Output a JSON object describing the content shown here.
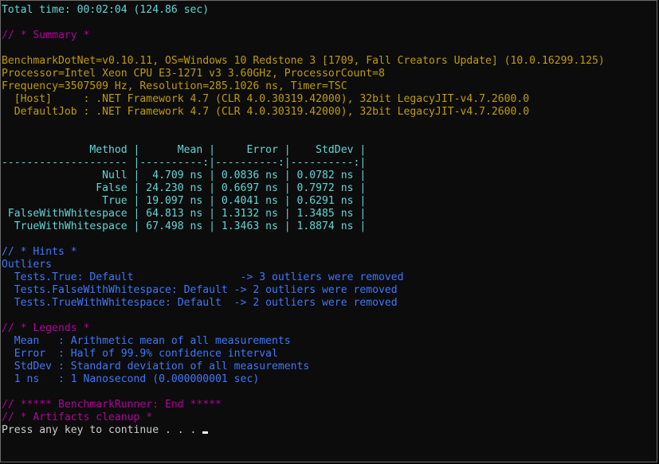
{
  "terminal": {
    "lines": [
      {
        "text": "Total time: 00:02:04 (124.86 sec)",
        "color": "cyan"
      },
      {
        "text": "",
        "color": "white"
      },
      {
        "text": "// * Summary *",
        "color": "magenta"
      },
      {
        "text": "",
        "color": "white"
      },
      {
        "text": "BenchmarkDotNet=v0.10.11, OS=Windows 10 Redstone 3 [1709, Fall Creators Update] (10.0.16299.125)",
        "color": "yellow"
      },
      {
        "text": "Processor=Intel Xeon CPU E3-1271 v3 3.60GHz, ProcessorCount=8",
        "color": "yellow"
      },
      {
        "text": "Frequency=3507509 Hz, Resolution=285.1026 ns, Timer=TSC",
        "color": "yellow"
      },
      {
        "text": "  [Host]     : .NET Framework 4.7 (CLR 4.0.30319.42000), 32bit LegacyJIT-v4.7.2600.0",
        "color": "yellow"
      },
      {
        "text": "  DefaultJob : .NET Framework 4.7 (CLR 4.0.30319.42000), 32bit LegacyJIT-v4.7.2600.0",
        "color": "yellow"
      },
      {
        "text": "",
        "color": "white"
      },
      {
        "text": "",
        "color": "white"
      },
      {
        "text": "              Method |      Mean |     Error |    StdDev |",
        "color": "cyan"
      },
      {
        "text": "-------------------- |----------:|----------:|----------:|",
        "color": "cyan"
      },
      {
        "text": "                Null |  4.709 ns | 0.0836 ns | 0.0782 ns |",
        "color": "cyan"
      },
      {
        "text": "               False | 24.230 ns | 0.6697 ns | 0.7972 ns |",
        "color": "cyan"
      },
      {
        "text": "                True | 19.097 ns | 0.4041 ns | 0.6291 ns |",
        "color": "cyan"
      },
      {
        "text": " FalseWithWhitespace | 64.813 ns | 1.3132 ns | 1.3485 ns |",
        "color": "cyan"
      },
      {
        "text": "  TrueWithWhitespace | 67.498 ns | 1.3463 ns | 1.8874 ns |",
        "color": "cyan"
      },
      {
        "text": "",
        "color": "white"
      },
      {
        "text": "// * Hints *",
        "color": "blue"
      },
      {
        "text": "Outliers",
        "color": "blue"
      },
      {
        "text": "  Tests.True: Default                 -> 3 outliers were removed",
        "color": "blue"
      },
      {
        "text": "  Tests.FalseWithWhitespace: Default -> 2 outliers were removed",
        "color": "blue"
      },
      {
        "text": "  Tests.TrueWithWhitespace: Default  -> 2 outliers were removed",
        "color": "blue"
      },
      {
        "text": "",
        "color": "white"
      },
      {
        "text": "// * Legends *",
        "color": "magenta"
      },
      {
        "text": "  Mean   : Arithmetic mean of all measurements",
        "color": "blue"
      },
      {
        "text": "  Error  : Half of 99.9% confidence interval",
        "color": "blue"
      },
      {
        "text": "  StdDev : Standard deviation of all measurements",
        "color": "blue"
      },
      {
        "text": "  1 ns   : 1 Nanosecond (0.000000001 sec)",
        "color": "blue"
      },
      {
        "text": "",
        "color": "white"
      },
      {
        "text": "// ***** BenchmarkRunner: End *****",
        "color": "magenta"
      },
      {
        "text": "// * Artifacts cleanup *",
        "color": "magenta"
      },
      {
        "text": "Press any key to continue . . . ",
        "color": "white",
        "cursor": true
      }
    ]
  },
  "colors": {
    "background": "#0c0c0c",
    "cyan": "#61d6d6",
    "magenta": "#b4009e",
    "yellow": "#c19c00",
    "blue": "#3b78ff",
    "white": "#cccccc"
  }
}
